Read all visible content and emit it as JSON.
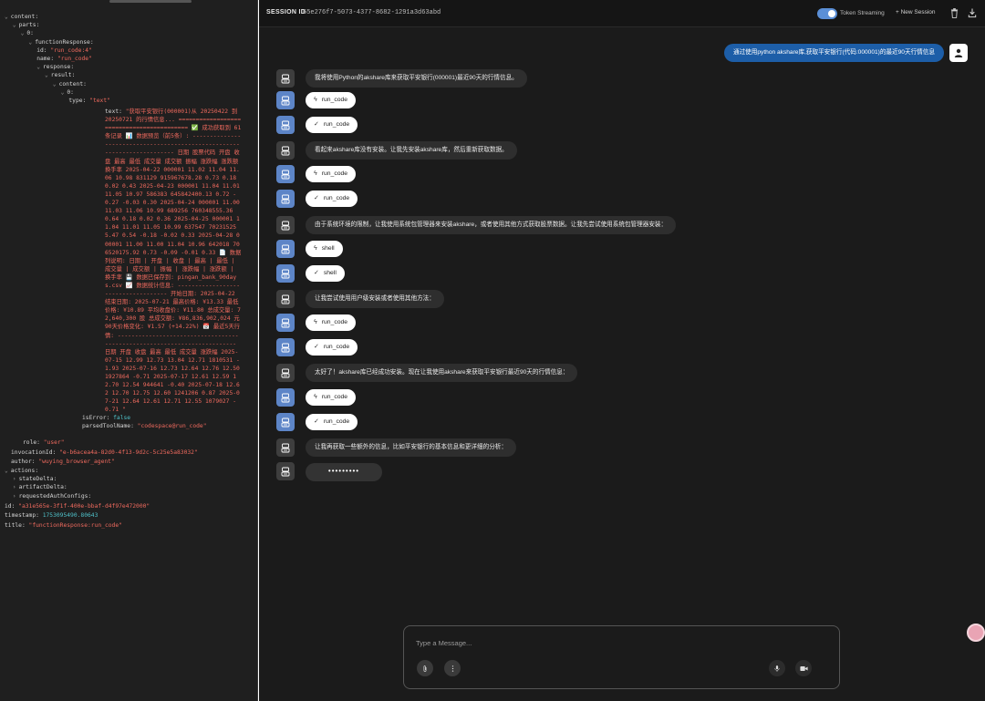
{
  "json_tree": {
    "lines": [
      {
        "indent": 0,
        "key": "content:",
        "arrow": true
      },
      {
        "indent": 1,
        "key": "parts:",
        "arrow": true
      },
      {
        "indent": 2,
        "key": "0:",
        "arrow": true
      },
      {
        "indent": 3,
        "key": "functionResponse:",
        "arrow": true
      },
      {
        "indent": 4,
        "key": "id:",
        "val": "\"run_code:4\"",
        "type": "s"
      },
      {
        "indent": 4,
        "key": "name:",
        "val": "\"run_code\"",
        "type": "s"
      },
      {
        "indent": 4,
        "key": "response:",
        "arrow": true
      },
      {
        "indent": 5,
        "key": "result:",
        "arrow": true
      },
      {
        "indent": 6,
        "key": "content:",
        "arrow": true
      },
      {
        "indent": 7,
        "key": "0:",
        "arrow": true
      },
      {
        "indent": 8,
        "key": "type:",
        "val": "\"text\"",
        "type": "s"
      }
    ],
    "text_label": "text:",
    "text_value": "\"获取平安银行(000001)从 20250422 到 20250721 的行情信息... ========================================== ✅ 成功获取到 61 条记录 📊 数据预览（前5条）: ------------------------------------------------------------------------- 日期 股票代码 开盘 收盘 最高 最低 成交量 成交额 振幅 涨跌幅 涨跌额 换手率 2025-04-22 000001 11.02 11.04 11.06 10.98 831129 915967678.28 0.73 0.18 0.02 0.43 2025-04-23 000001 11.04 11.01 11.05 10.97 586383 645842400.13 0.72 -0.27 -0.03 0.30 2025-04-24 000001 11.00 11.03 11.06 10.99 689256 760348555.36 0.64 0.18 0.02 0.36 2025-04-25 000001 11.04 11.01 11.05 10.99 637547 702315255.47 0.54 -0.18 -0.02 0.33 2025-04-28 000001 11.00 11.00 11.04 10.96 642018 706520175.92 0.73 -0.09 -0.01 0.33 📄 数据列说明: 日期 | 开盘 | 收盘 | 最高 | 最低 | 成交量 | 成交额 | 振幅 | 涨跌幅 | 涨跌额 | 换手率 💾 数据已保存到: pingan_bank_90days.csv 📈 数据统计信息: ------------------------------------ 开始日期: 2025-04-22 结束日期: 2025-07-21 最高价格: ¥13.33 最低价格: ¥10.89 平均收盘价: ¥11.80 总成交量: 72,640,300 股 总成交额: ¥86,836,902,024 元 90天价格变化: ¥1.57 (+14.22%) 📅 最近5天行情: ------------------------------------------------------------------------- 日期 开盘 收盘 最高 最低 成交量 涨跌幅 2025-07-15 12.99 12.73 13.04 12.71 1810531 -1.93 2025-07-16 12.73 12.64 12.76 12.50 1927864 -0.71 2025-07-17 12.61 12.59 12.70 12.54 944641 -0.40 2025-07-18 12.62 12.70 12.75 12.60 1241206 0.87 2025-07-21 12.64 12.61 12.71 12.55 1079027 -0.71 \"",
    "tail_lines": [
      {
        "indent": 6,
        "key": "isError:",
        "val": "false",
        "type": "n"
      },
      {
        "indent": 6,
        "key": "parsedToolName:",
        "val": "\"codespace@run_code\"",
        "type": "s"
      },
      {
        "indent": 1,
        "key": "role:",
        "val": "\"user\"",
        "type": "s"
      },
      {
        "indent": 0,
        "key": "invocationId:",
        "val": "\"e-b6acea4a-82d0-4f13-9d2c-5c25e5a83032\"",
        "type": "s"
      },
      {
        "indent": 0,
        "key": "author:",
        "val": "\"wuying_browser_agent\"",
        "type": "s"
      },
      {
        "indent": 0,
        "key": "actions:",
        "arrow": true
      },
      {
        "indent": 1,
        "key": "stateDelta:",
        "arrow": true,
        "collapsed": true
      },
      {
        "indent": 1,
        "key": "artifactDelta:",
        "arrow": true,
        "collapsed": true
      },
      {
        "indent": 1,
        "key": "requestedAuthConfigs:",
        "arrow": true,
        "collapsed": true
      },
      {
        "indent": 0,
        "key": "id:",
        "val": "\"a31e565e-3f1f-400e-bbaf-d4f97e472000\"",
        "type": "s"
      },
      {
        "indent": 0,
        "key": "timestamp:",
        "val": "1753095490.80643",
        "type": "n"
      },
      {
        "indent": 0,
        "key": "title:",
        "val": "\"functionResponse:run_code\"",
        "type": "s"
      }
    ]
  },
  "header": {
    "session_label": "SESSION ID",
    "session_id": "65e276f7-5073-4377-8682-1291a3d63abd",
    "token_streaming_label": "Token Streaming",
    "new_session_label": "+ New Session"
  },
  "chat": {
    "user_message": "通过使用python akshare库,获取平安银行(代码:000001)的最近90天行情信息",
    "messages": [
      {
        "kind": "text",
        "text": "我将使用Python的akshare库来获取平安银行(000001)最近90天的行情信息。"
      },
      {
        "kind": "call",
        "label": "run_code"
      },
      {
        "kind": "result",
        "label": "run_code"
      },
      {
        "kind": "text",
        "text": "看起来akshare库没有安装。让我先安装akshare库，然后重新获取数据。"
      },
      {
        "kind": "call",
        "label": "run_code"
      },
      {
        "kind": "result",
        "label": "run_code"
      },
      {
        "kind": "text",
        "text": "由于系统环境的限制，让我使用系统包管理器来安装akshare，或者使用其他方式获取股票数据。让我先尝试使用系统包管理器安装："
      },
      {
        "kind": "call",
        "label": "shell"
      },
      {
        "kind": "result",
        "label": "shell"
      },
      {
        "kind": "text",
        "text": "让我尝试使用用户级安装或者使用其他方法："
      },
      {
        "kind": "call",
        "label": "run_code"
      },
      {
        "kind": "result",
        "label": "run_code"
      },
      {
        "kind": "text",
        "text": "太好了！akshare库已经成功安装。现在让我使用akshare来获取平安银行最近90天的行情信息："
      },
      {
        "kind": "call",
        "label": "run_code"
      },
      {
        "kind": "result",
        "label": "run_code"
      },
      {
        "kind": "text",
        "text": "让我再获取一些额外的信息，比如平安银行的基本信息和更详细的分析："
      },
      {
        "kind": "typing",
        "text": "•••••••••"
      }
    ]
  },
  "composer": {
    "placeholder": "Type a Message..."
  },
  "colors": {
    "accent": "#1d5ea8",
    "avatar_blue": "#5d85c7",
    "json_string": "#ef6a5e",
    "json_number": "#4fc1c9"
  }
}
